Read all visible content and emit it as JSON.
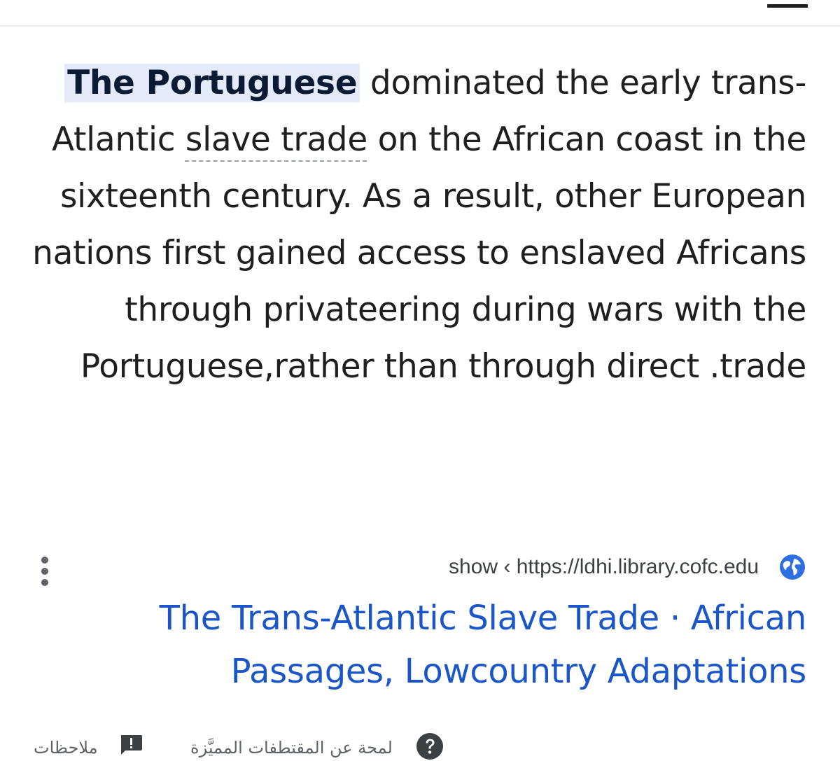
{
  "snippet": {
    "highlight": "The Portuguese",
    "text_1": " dominated the early trans-Atlantic ",
    "link_term": "slave trade",
    "text_2": " on the African coast in the sixteenth century. As a result, other European nations first gained access to enslaved Africans through privateering during wars with the Portuguese,rather than through direct .trade"
  },
  "source": {
    "url": "show ‹ https://ldhi.library.cofc.edu",
    "site_icon": "globe-icon",
    "menu_icon": "more-vert-icon"
  },
  "result": {
    "title_line_1": "The Trans-Atlantic Slave Trade · African",
    "title_line_2": "Passages, Lowcountry Adaptations"
  },
  "footer": {
    "feedback_label": "ملاحظات",
    "feedback_icon": "feedback-icon",
    "about_label": "لمحة عن المقتطفات المميَّزة",
    "about_icon": "help-icon"
  },
  "colors": {
    "highlight_bg": "#e3ebfb",
    "link": "#1a56c8",
    "text": "#1f1f1f",
    "secondary": "#5f6368",
    "globe": "#2f6ee0"
  }
}
